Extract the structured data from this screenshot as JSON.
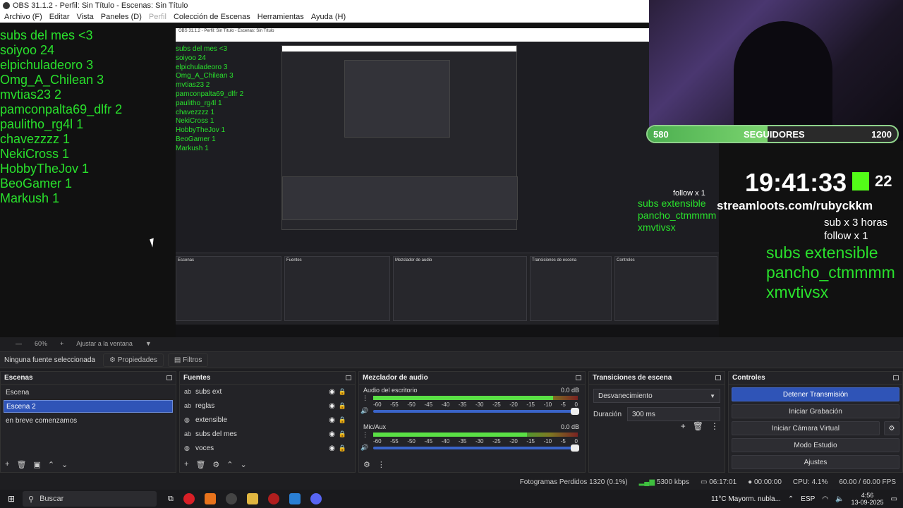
{
  "window": {
    "title": "OBS 31.1.2 - Perfil: Sin Título - Escenas: Sin Título"
  },
  "menu": [
    "Archivo (F)",
    "Editar",
    "Vista",
    "Paneles (D)",
    "Perfil",
    "Colección de Escenas",
    "Herramientas",
    "Ayuda (H)"
  ],
  "overlay": {
    "subs_list": [
      "subs del mes <3",
      "soiyoo 24",
      "elpichuladeoro 3",
      "Omg_A_Chilean 3",
      "mvtias23 2",
      "pamconpalta69_dlfr 2",
      "paulitho_rg4l 1",
      "chavezzzz 1",
      "NekiCross 1",
      "HobbyTheJov 1",
      "BeoGamer 1",
      "Markush 1"
    ],
    "followers": {
      "current": "580",
      "label": "SEGUIDORES",
      "goal": "1200",
      "fraction": 0.48
    },
    "clock": "19:41:33",
    "kick_count": "22",
    "streamloots": "streamloots.com/rubyckkm",
    "rules": [
      "sub x 3 horas",
      "follow x 1"
    ],
    "goals": [
      "subs extensible",
      "pancho_ctmmmm",
      "xmvtivsx"
    ],
    "echo_follow": "follow x 1",
    "echo_clock": "19:41:33",
    "echo_loots": "streamloots.com/rubyckkm"
  },
  "zoom": {
    "level": "60%",
    "fit": "Ajustar a la ventana"
  },
  "properties_bar": {
    "no_selection": "Ninguna fuente seleccionada",
    "properties": "Propiedades",
    "filters": "Filtros"
  },
  "scenes": {
    "title": "Escenas",
    "items": [
      "Escena",
      "Escena 2",
      "en breve comenzamos"
    ],
    "selected": 1
  },
  "sources": {
    "title": "Fuentes",
    "items": [
      {
        "name": "subs ext",
        "icon": "text-icon"
      },
      {
        "name": "reglas",
        "icon": "text-icon"
      },
      {
        "name": "extensible",
        "icon": "browser-icon"
      },
      {
        "name": "subs del mes",
        "icon": "text-icon"
      },
      {
        "name": "voces",
        "icon": "browser-icon"
      }
    ]
  },
  "mixer": {
    "title": "Mezclador de audio",
    "tracks": [
      {
        "name": "Audio del escritorio",
        "db": "0.0 dB",
        "level": 0.88
      },
      {
        "name": "Mic/Aux",
        "db": "0.0 dB",
        "level": 0.75
      }
    ],
    "ticks": [
      "-60",
      "-55",
      "-50",
      "-45",
      "-40",
      "-35",
      "-30",
      "-25",
      "-20",
      "-15",
      "-10",
      "-5",
      "0"
    ]
  },
  "transitions": {
    "title": "Transiciones de escena",
    "selected": "Desvanecimiento",
    "duration_label": "Duración",
    "duration": "300 ms"
  },
  "controls": {
    "title": "Controles",
    "stop_stream": "Detener Transmisión",
    "start_record": "Iniciar Grabación",
    "virtual_cam": "Iniciar Cámara Virtual",
    "studio": "Modo Estudio",
    "settings": "Ajustes"
  },
  "status": {
    "dropped": "Fotogramas Perdidos 1320 (0.1%)",
    "bitrate": "5300 kbps",
    "stream_time": "06:17:01",
    "record_time": "00:00:00",
    "cpu": "CPU: 4.1%",
    "fps": "60.00 / 60.00 FPS"
  },
  "taskbar": {
    "search": "Buscar",
    "weather": "11°C  Mayorm. nubla...",
    "lang": "ESP",
    "time": "4:56",
    "date": "13-09-2025"
  },
  "colors": {
    "accent": "#2f54b7",
    "overlay_green": "#29e12c",
    "kick_green": "#53fc18"
  }
}
